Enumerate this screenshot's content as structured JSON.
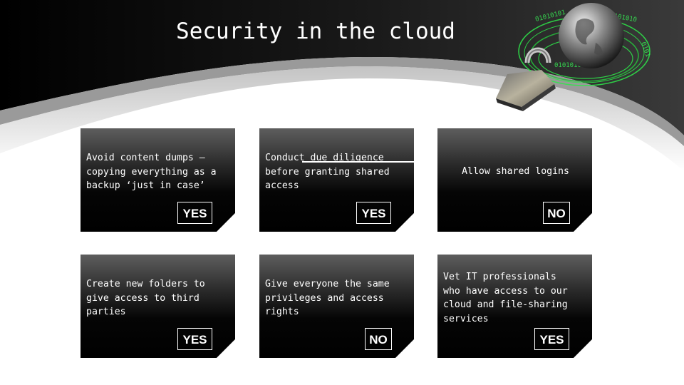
{
  "slide": {
    "title": "Security in the cloud",
    "hero_image": "padlock-and-globe-with-binary-rings-icon",
    "colors": {
      "header_dark": "#000000",
      "card_top": "#5e5e5e",
      "card_bottom": "#000000",
      "binary_ring_green": "#2ecc40",
      "text": "#ffffff"
    }
  },
  "cards": [
    {
      "text": "Avoid content dumps –\ncopying everything as a\nbackup ‘just in case’",
      "answer": "YES"
    },
    {
      "text": "Conduct due diligence\nbefore granting shared\naccess",
      "answer": "YES"
    },
    {
      "text": "Allow shared logins",
      "answer": "NO"
    },
    {
      "text": "Create new folders to\ngive access to third\nparties",
      "answer": "YES"
    },
    {
      "text": "Give everyone the same\nprivileges and access\nrights",
      "answer": "NO"
    },
    {
      "text": "Vet IT professionals\nwho have access to our\ncloud and file-sharing\nservices",
      "answer": "YES"
    }
  ]
}
